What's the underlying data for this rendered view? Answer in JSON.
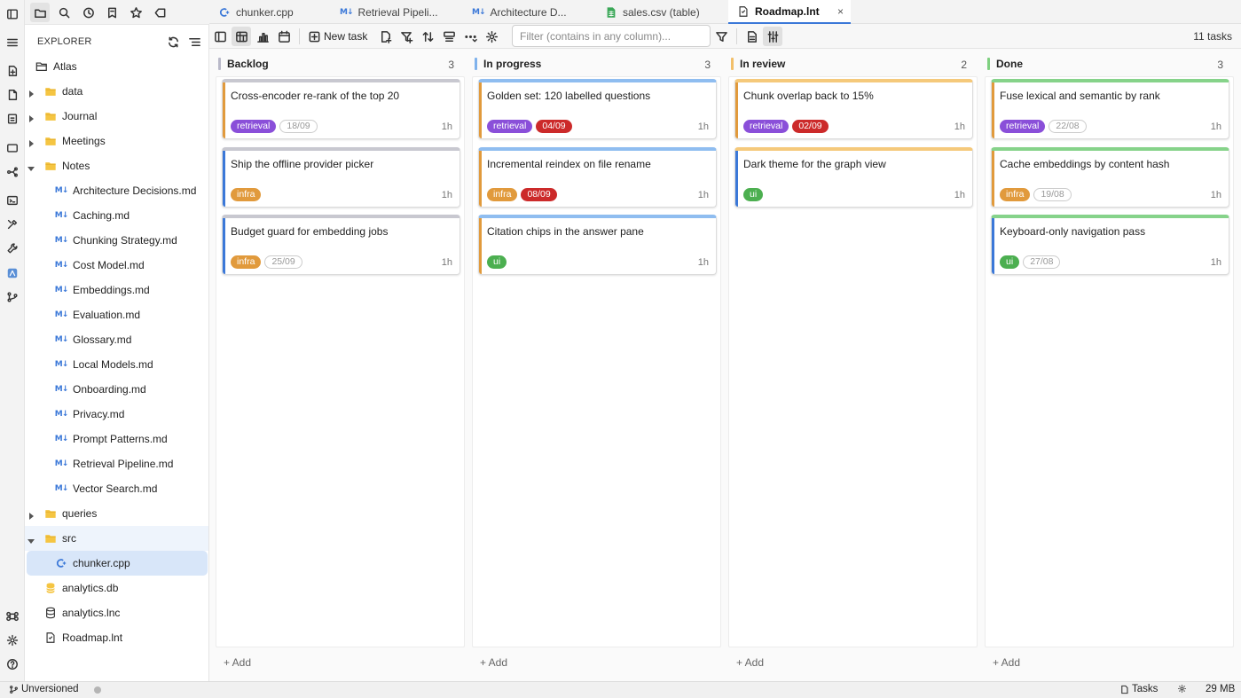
{
  "activity_bar": [
    "sidebar-toggle-icon",
    "menu-icon",
    "new-note-icon",
    "document-icon",
    "note-icon",
    "window-icon",
    "graph-icon",
    "terminal-icon",
    "tools-icon",
    "build-icon",
    "app-icon",
    "git-icon",
    "command-icon",
    "settings-icon",
    "help-icon"
  ],
  "sidebar": {
    "tabs": [
      "folder-icon",
      "search-icon",
      "history-icon",
      "bookmark-list-icon",
      "star-icon",
      "tag-icon"
    ],
    "explorer_label": "EXPLORER",
    "tree": [
      {
        "label": "Atlas",
        "kind": "folder-open",
        "depth": 0
      },
      {
        "label": "data",
        "kind": "folder",
        "depth": 1,
        "caret": "right"
      },
      {
        "label": "Journal",
        "kind": "folder",
        "depth": 1,
        "caret": "right"
      },
      {
        "label": "Meetings",
        "kind": "folder",
        "depth": 1,
        "caret": "right"
      },
      {
        "label": "Notes",
        "kind": "folder",
        "depth": 1,
        "caret": "down"
      },
      {
        "label": "Architecture Decisions.md",
        "kind": "md",
        "depth": 2
      },
      {
        "label": "Caching.md",
        "kind": "md",
        "depth": 2
      },
      {
        "label": "Chunking Strategy.md",
        "kind": "md",
        "depth": 2
      },
      {
        "label": "Cost Model.md",
        "kind": "md",
        "depth": 2
      },
      {
        "label": "Embeddings.md",
        "kind": "md",
        "depth": 2
      },
      {
        "label": "Evaluation.md",
        "kind": "md",
        "depth": 2
      },
      {
        "label": "Glossary.md",
        "kind": "md",
        "depth": 2
      },
      {
        "label": "Local Models.md",
        "kind": "md",
        "depth": 2
      },
      {
        "label": "Onboarding.md",
        "kind": "md",
        "depth": 2
      },
      {
        "label": "Privacy.md",
        "kind": "md",
        "depth": 2
      },
      {
        "label": "Prompt Patterns.md",
        "kind": "md",
        "depth": 2
      },
      {
        "label": "Retrieval Pipeline.md",
        "kind": "md",
        "depth": 2
      },
      {
        "label": "Vector Search.md",
        "kind": "md",
        "depth": 2
      },
      {
        "label": "queries",
        "kind": "folder",
        "depth": 1,
        "caret": "right"
      },
      {
        "label": "src",
        "kind": "folder",
        "depth": 1,
        "caret": "down",
        "state": "highlight"
      },
      {
        "label": "chunker.cpp",
        "kind": "cpp",
        "depth": 2,
        "state": "selected"
      },
      {
        "label": "analytics.db",
        "kind": "db",
        "depth": 1
      },
      {
        "label": "analytics.lnc",
        "kind": "db2",
        "depth": 1
      },
      {
        "label": "Roadmap.lnt",
        "kind": "lnt",
        "depth": 1
      }
    ]
  },
  "tabs": [
    {
      "label": "chunker.cpp",
      "icon": "cpp",
      "active": false
    },
    {
      "label": "Retrieval Pipeli...",
      "icon": "md",
      "active": false
    },
    {
      "label": "Architecture D...",
      "icon": "md",
      "active": false
    },
    {
      "label": "sales.csv (table)",
      "icon": "csv",
      "active": false
    },
    {
      "label": "Roadmap.lnt",
      "icon": "lnt",
      "active": true,
      "close": "×"
    }
  ],
  "toolbar": {
    "new_task": "New task",
    "filter_placeholder": "Filter (contains in any column)...",
    "task_count": "11 tasks"
  },
  "colors": {
    "retrieval": "#8a4fd9",
    "infra": "#e19a3c",
    "ui": "#4caf50",
    "due": "#cc2a2a",
    "accent": "#3b78d8"
  },
  "board": {
    "add_label": "+ Add",
    "columns": [
      {
        "title": "Backlog",
        "count": "3",
        "bar": "#b9b9c9",
        "cards": [
          {
            "title": "Cross-encoder re-rank of the top 20",
            "top": "#c8c8d0",
            "left": "#e19a3c",
            "tags": [
              {
                "text": "retrieval",
                "cls": "retrieval"
              },
              {
                "text": "18/09",
                "cls": "date"
              }
            ],
            "est": "1h"
          },
          {
            "title": "Ship the offline provider picker",
            "top": "#c8c8d0",
            "left": "#3b78d8",
            "tags": [
              {
                "text": "infra",
                "cls": "infra"
              }
            ],
            "est": "1h"
          },
          {
            "title": "Budget guard for embedding jobs",
            "top": "#c8c8d0",
            "left": "#3b78d8",
            "tags": [
              {
                "text": "infra",
                "cls": "infra"
              },
              {
                "text": "25/09",
                "cls": "date"
              }
            ],
            "est": "1h"
          }
        ]
      },
      {
        "title": "In progress",
        "count": "3",
        "bar": "#7fb2ec",
        "cards": [
          {
            "title": "Golden set: 120 labelled questions",
            "top": "#8fbdf0",
            "left": "#e19a3c",
            "tags": [
              {
                "text": "retrieval",
                "cls": "retrieval"
              },
              {
                "text": "04/09",
                "cls": "due"
              }
            ],
            "est": "1h"
          },
          {
            "title": "Incremental reindex on file rename",
            "top": "#8fbdf0",
            "left": "#e19a3c",
            "tags": [
              {
                "text": "infra",
                "cls": "infra"
              },
              {
                "text": "08/09",
                "cls": "due"
              }
            ],
            "est": "1h"
          },
          {
            "title": "Citation chips in the answer pane",
            "top": "#8fbdf0",
            "left": "#e19a3c",
            "tags": [
              {
                "text": "ui",
                "cls": "ui"
              }
            ],
            "est": "1h"
          }
        ]
      },
      {
        "title": "In review",
        "count": "2",
        "bar": "#f2bf6a",
        "cards": [
          {
            "title": "Chunk overlap back to 15%",
            "top": "#f5c97b",
            "left": "#e19a3c",
            "tags": [
              {
                "text": "retrieval",
                "cls": "retrieval"
              },
              {
                "text": "02/09",
                "cls": "due"
              }
            ],
            "est": "1h"
          },
          {
            "title": "Dark theme for the graph view",
            "top": "#f5c97b",
            "left": "#3b78d8",
            "tags": [
              {
                "text": "ui",
                "cls": "ui"
              }
            ],
            "est": "1h"
          }
        ]
      },
      {
        "title": "Done",
        "count": "3",
        "bar": "#7fd080",
        "cards": [
          {
            "title": "Fuse lexical and semantic by rank",
            "top": "#86d38a",
            "left": "#e19a3c",
            "tags": [
              {
                "text": "retrieval",
                "cls": "retrieval"
              },
              {
                "text": "22/08",
                "cls": "date"
              }
            ],
            "est": "1h"
          },
          {
            "title": "Cache embeddings by content hash",
            "top": "#86d38a",
            "left": "#e19a3c",
            "tags": [
              {
                "text": "infra",
                "cls": "infra"
              },
              {
                "text": "19/08",
                "cls": "date"
              }
            ],
            "est": "1h"
          },
          {
            "title": "Keyboard-only navigation pass",
            "top": "#86d38a",
            "left": "#3b78d8",
            "tags": [
              {
                "text": "ui",
                "cls": "ui"
              },
              {
                "text": "27/08",
                "cls": "date"
              }
            ],
            "est": "1h"
          }
        ]
      }
    ]
  },
  "status": {
    "vcs": "Unversioned",
    "tasks": "Tasks",
    "memory": "29 MB"
  }
}
